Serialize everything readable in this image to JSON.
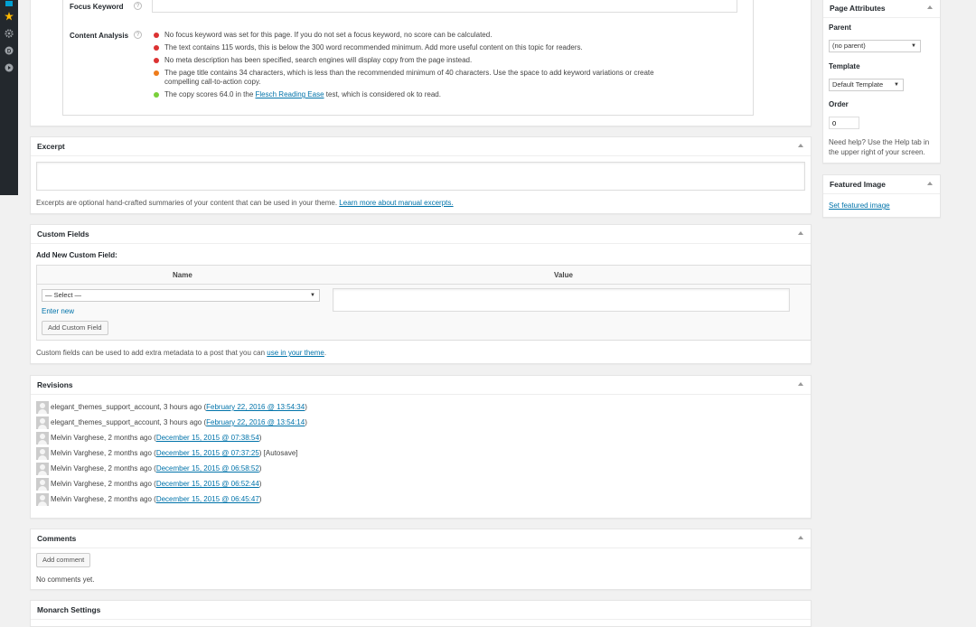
{
  "seo": {
    "focus_keyword_label": "Focus Keyword",
    "focus_keyword_value": "",
    "content_analysis_label": "Content Analysis",
    "help_glyph": "?",
    "analysis": [
      {
        "status": "bad",
        "color": "#dc3232",
        "text": "No focus keyword was set for this page. If you do not set a focus keyword, no score can be calculated."
      },
      {
        "status": "bad",
        "color": "#dc3232",
        "text": "The text contains 115 words, this is below the 300 word recommended minimum. Add more useful content on this topic for readers."
      },
      {
        "status": "bad",
        "color": "#dc3232",
        "text": "No meta description has been specified, search engines will display copy from the page instead."
      },
      {
        "status": "ok",
        "color": "#ee7c1b",
        "text": "The page title contains 34 characters, which is less than the recommended minimum of 40 characters. Use the space to add keyword variations or create compelling call-to-action copy."
      },
      {
        "status": "good",
        "color": "#7ad03a",
        "text_before": "The copy scores 64.0 in the ",
        "link": "Flesch Reading Ease",
        "text_after": " test, which is considered ok to read."
      }
    ]
  },
  "excerpt": {
    "title": "Excerpt",
    "value": "",
    "desc": "Excerpts are optional hand-crafted summaries of your content that can be used in your theme. ",
    "link": "Learn more about manual excerpts."
  },
  "custom_fields": {
    "title": "Custom Fields",
    "add_new_label": "Add New Custom Field:",
    "col_name": "Name",
    "col_value": "Value",
    "select_value": "— Select —",
    "enter_new": "Enter new",
    "add_button": "Add Custom Field",
    "desc": "Custom fields can be used to add extra metadata to a post that you can ",
    "desc_link": "use in your theme",
    "desc_end": "."
  },
  "revisions": {
    "title": "Revisions",
    "items": [
      {
        "author": "elegant_themes_support_account, 3 hours ago (",
        "link": "February 22, 2016 @ 13:54:34",
        "suffix": ")"
      },
      {
        "author": "elegant_themes_support_account, 3 hours ago (",
        "link": "February 22, 2016 @ 13:54:14",
        "suffix": ")"
      },
      {
        "author": "Melvin Varghese, 2 months ago (",
        "link": "December 15, 2015 @ 07:38:54",
        "suffix": ")"
      },
      {
        "author": "Melvin Varghese, 2 months ago (",
        "link": "December 15, 2015 @ 07:37:25",
        "suffix": ") [Autosave]"
      },
      {
        "author": "Melvin Varghese, 2 months ago (",
        "link": "December 15, 2015 @ 06:58:52",
        "suffix": ")"
      },
      {
        "author": "Melvin Varghese, 2 months ago (",
        "link": "December 15, 2015 @ 06:52:44",
        "suffix": ")"
      },
      {
        "author": "Melvin Varghese, 2 months ago (",
        "link": "December 15, 2015 @ 06:45:47",
        "suffix": ")"
      }
    ]
  },
  "comments": {
    "title": "Comments",
    "add_button": "Add comment",
    "empty": "No comments yet."
  },
  "monarch": {
    "title": "Monarch Settings"
  },
  "page_attributes": {
    "title": "Page Attributes",
    "parent_label": "Parent",
    "parent_value": "(no parent)",
    "template_label": "Template",
    "template_value": "Default Template",
    "order_label": "Order",
    "order_value": "0",
    "help": "Need help? Use the Help tab in the upper right of your screen."
  },
  "featured_image": {
    "title": "Featured Image",
    "link": "Set featured image"
  },
  "icons": {
    "admin_bar": [
      "media-icon",
      "star-icon",
      "gear-icon",
      "divi-icon",
      "play-icon"
    ],
    "colors": {
      "accent": "#0073aa",
      "adminbar": "#23282d",
      "media": "#00a0d2",
      "star": "#ffb900"
    }
  }
}
